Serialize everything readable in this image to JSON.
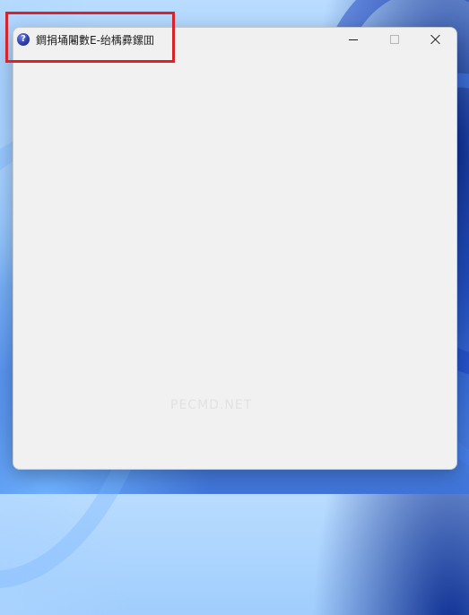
{
  "window": {
    "title": "鐧捐埇闂數E-绐楀彛鏍囬"
  },
  "icons": {
    "app": "question-mark-icon",
    "minimize": "minimize-icon",
    "maximize": "maximize-icon",
    "close": "close-icon"
  },
  "app_icon_glyph": "?",
  "watermark": "PECMD.NET",
  "colors": {
    "highlight": "#d8232a",
    "window_background": "#f1f1f1",
    "app_icon": "#2f3fa8"
  }
}
